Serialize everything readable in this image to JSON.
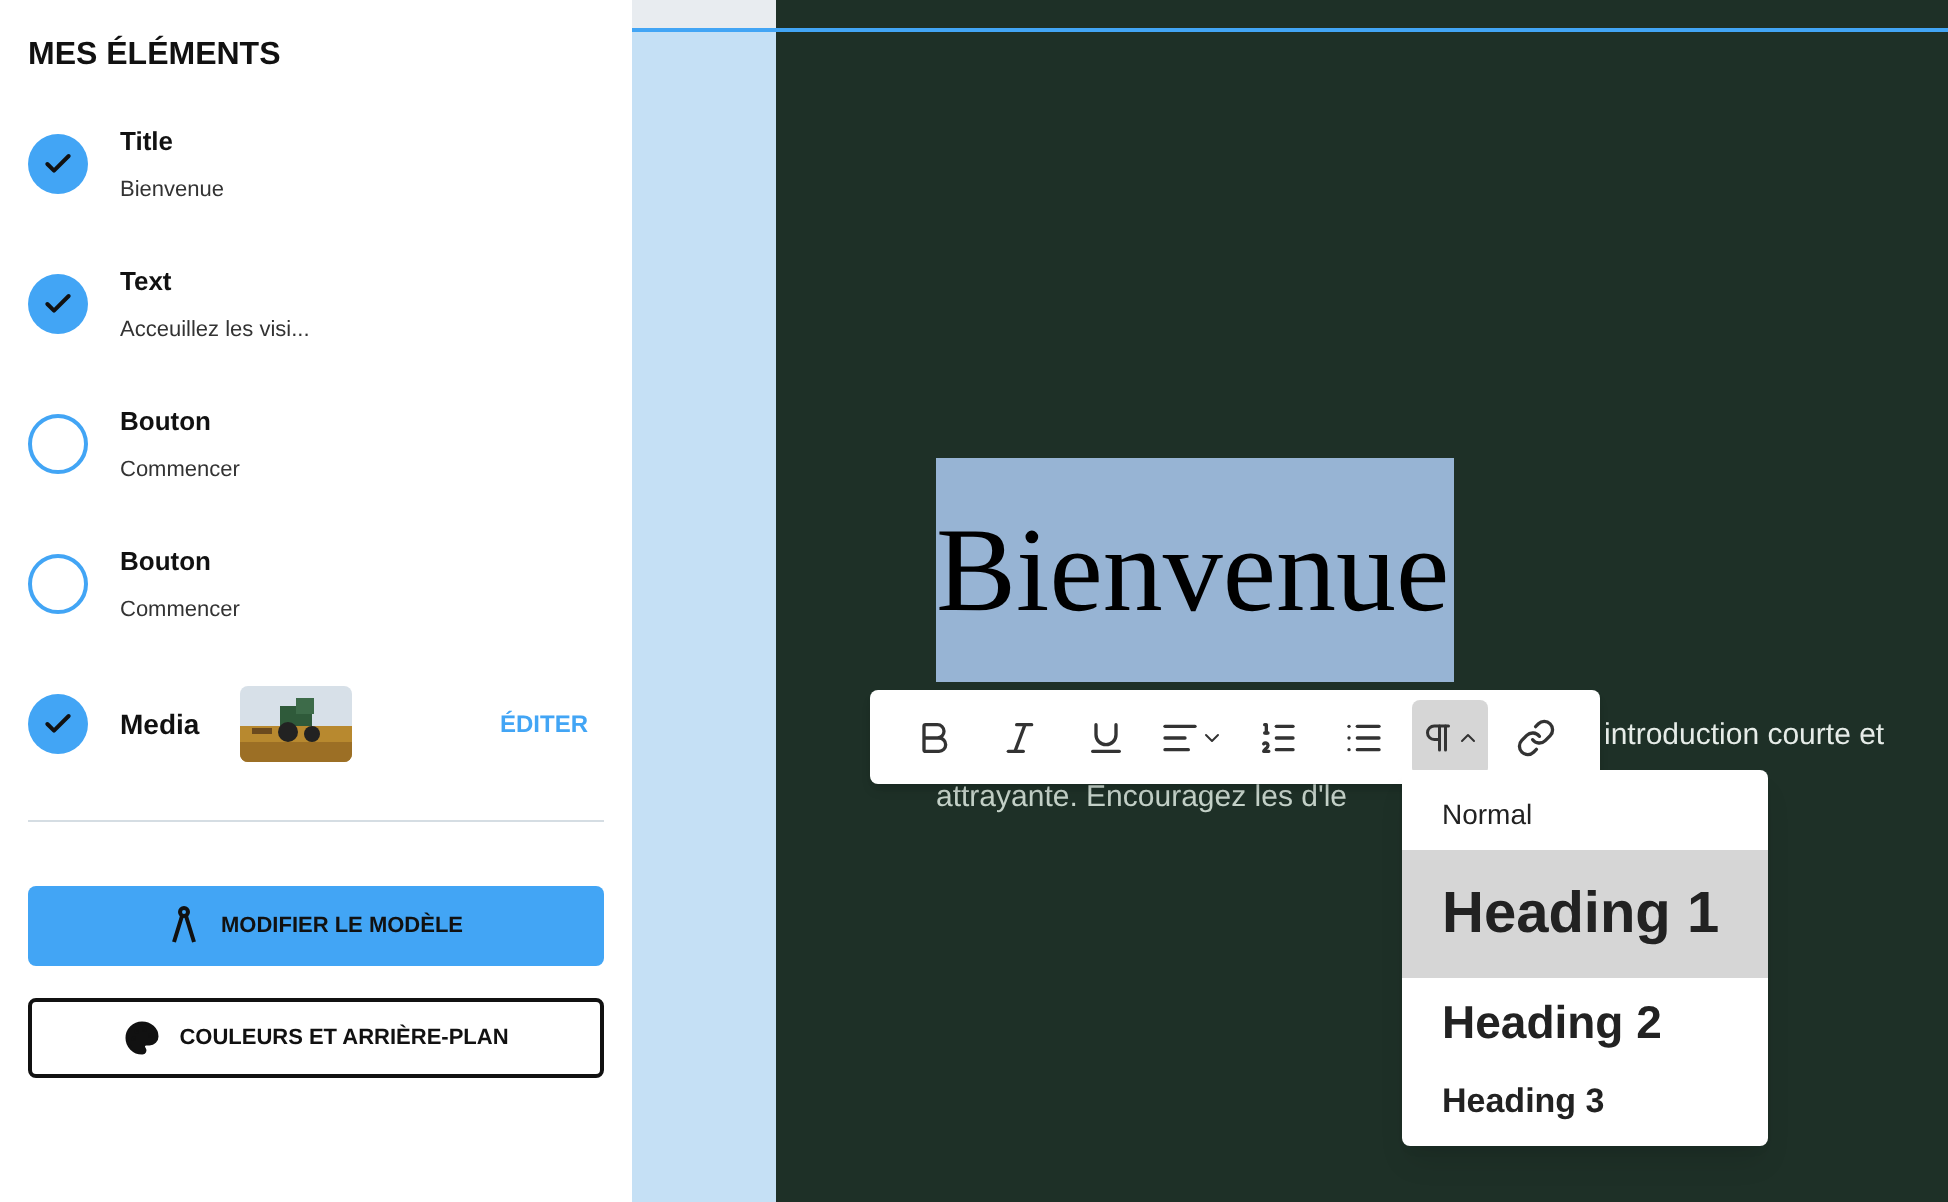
{
  "sidebar": {
    "title": "MES ÉLÉMENTS",
    "items": [
      {
        "kind": "text",
        "label": "Title",
        "value": "Bienvenue",
        "checked": true
      },
      {
        "kind": "text",
        "label": "Text",
        "value": "Acceuillez les visi...",
        "checked": true
      },
      {
        "kind": "text",
        "label": "Bouton",
        "value": "Commencer",
        "checked": false
      },
      {
        "kind": "text",
        "label": "Bouton",
        "value": "Commencer",
        "checked": false
      },
      {
        "kind": "media",
        "label": "Media",
        "action": "ÉDITER",
        "checked": true
      }
    ],
    "buttons": [
      {
        "kind": "primary",
        "label": "MODIFIER LE MODÈLE"
      },
      {
        "kind": "outline",
        "label": "COULEURS ET ARRIÈRE-PLAN"
      }
    ]
  },
  "canvas": {
    "heading": "Bienvenue",
    "paragraph_line_1": "introduction courte et",
    "paragraph_line_2": "attrayante. Encouragez les d'le"
  },
  "toolbar": [
    {
      "kind": "bold",
      "selected": false
    },
    {
      "kind": "italic",
      "selected": false
    },
    {
      "kind": "underline",
      "selected": false
    },
    {
      "kind": "align",
      "selected": false
    },
    {
      "kind": "ordered",
      "selected": false
    },
    {
      "kind": "bullets",
      "selected": false
    },
    {
      "kind": "paragraph",
      "selected": true
    },
    {
      "kind": "link",
      "selected": false
    }
  ],
  "format_menu": [
    {
      "kind": "normal",
      "label": "Normal",
      "selected": false
    },
    {
      "kind": "h1",
      "label": "Heading 1",
      "selected": true
    },
    {
      "kind": "h2",
      "label": "Heading 2",
      "selected": false
    },
    {
      "kind": "h3",
      "label": "Heading 3",
      "selected": false
    }
  ]
}
